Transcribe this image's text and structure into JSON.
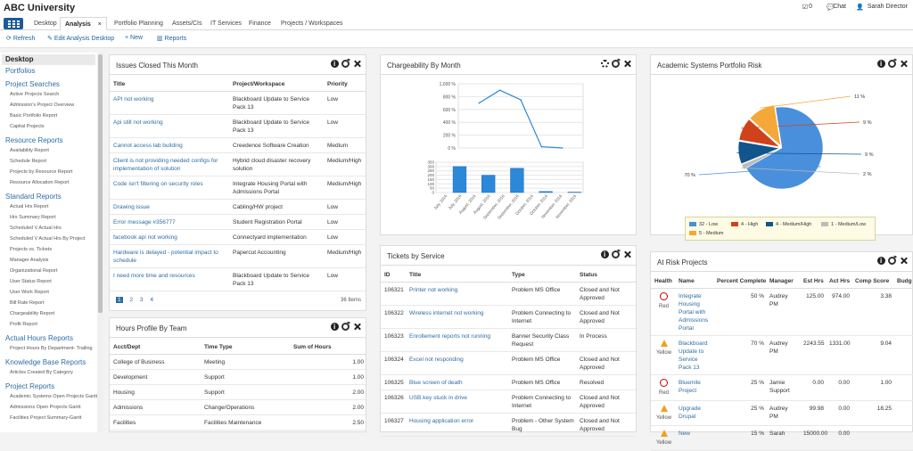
{
  "app": {
    "title": "ABC University",
    "checks_count": "0",
    "chat_label": "Chat",
    "user_name": "Sarah Director"
  },
  "tabs": [
    {
      "label": "Desktop"
    },
    {
      "label": "Analysis"
    },
    {
      "label": "Portfolio Planning"
    },
    {
      "label": "Assets/CIs"
    },
    {
      "label": "IT Services"
    },
    {
      "label": "Finance"
    },
    {
      "label": "Projects / Workspaces"
    }
  ],
  "toolbar": {
    "refresh": "Refresh",
    "edit": "Edit Analysis Desktop",
    "new": "New",
    "reports": "Reports"
  },
  "sidebar": {
    "desktop": "Desktop",
    "portfolios": "Portfolios",
    "project_searches": "Project Searches",
    "project_searches_items": [
      "Active Projects Search",
      "Admission's Project Overview",
      "Basic Portfolio Report",
      "Capital Projects"
    ],
    "resource_reports": "Resource Reports",
    "resource_reports_items": [
      "Availability Report",
      "Schedule Report",
      "Projects by Resource Report",
      "Resource Allocation Report"
    ],
    "standard_reports": "Standard Reports",
    "standard_reports_items": [
      "Actual Hrs Report",
      "Hrs Summary Report",
      "Scheduled V Actual Hrs",
      "Scheduled V Actual Hrs By Project",
      "Projects vs. Tickets",
      "Manager Analysis",
      "Organizational Report",
      "User Status Report",
      "User Work Report",
      "Bill Rate Report",
      "Chargeability Report",
      "Profit Report"
    ],
    "actual_hours_reports": "Actual Hours Reports",
    "actual_hours_items": [
      "Project Hours By Department- Trailing"
    ],
    "knowledge_base_reports": "Knowledge Base Reports",
    "knowledge_base_items": [
      "Articles Created By Category"
    ],
    "project_reports": "Project Reports",
    "project_reports_items": [
      "Academic Systems Open Projects Gantt",
      "Admissions Open Projects Gantt",
      "Facilities Project Summary-Gantt"
    ]
  },
  "issues": {
    "title": "Issues Closed This Month",
    "columns": [
      "Title",
      "Project/Workspace",
      "Priority"
    ],
    "rows": [
      {
        "title": "API not working",
        "project": "Blackboard Update to Service Pack 13",
        "priority": "Low"
      },
      {
        "title": "Api still not working",
        "project": "Blackboard Update to Service Pack 13",
        "priority": "Low"
      },
      {
        "title": "Cannot access lab building",
        "project": "Creedence Software Creation",
        "priority": "Medium"
      },
      {
        "title": "Client is not providing needed configs for implementation of solution",
        "project": "Hybrid cloud disaster recovery solution",
        "priority": "Medium/High"
      },
      {
        "title": "Code isn't filtering on security roles",
        "project": "Integrate Housing Portal with Admissions Portal",
        "priority": "Medium/High"
      },
      {
        "title": "Drawing issue",
        "project": "Cabling/HW project",
        "priority": "Low"
      },
      {
        "title": "Error message #356777",
        "project": "Student Registration Portal",
        "priority": "Low"
      },
      {
        "title": "facebook api not working",
        "project": "Connectyard implementation",
        "priority": "Low"
      },
      {
        "title": "Hardware is delayed - potential impact to schedule",
        "project": "Papercut Accounting",
        "priority": "Medium/High"
      },
      {
        "title": "I need more time and resources",
        "project": "Blackboard Update to Service Pack 13",
        "priority": "Low"
      }
    ],
    "pages": [
      "1",
      "2",
      "3",
      "4"
    ],
    "items_count": "36 Items"
  },
  "hours": {
    "title": "Hours Profile By Team",
    "columns": [
      "Acct/Dept",
      "Time Type",
      "Sum of Hours"
    ],
    "rows": [
      {
        "dept": "College of Business",
        "type": "Meeting",
        "sum": "1.00"
      },
      {
        "dept": "Development",
        "type": "Support",
        "sum": "1.00"
      },
      {
        "dept": "Housing",
        "type": "Support",
        "sum": "2.00"
      },
      {
        "dept": "Admissions",
        "type": "Change/Operations",
        "sum": "2.00"
      },
      {
        "dept": "Facilities",
        "type": "Facilities Maintenance",
        "sum": "2.50"
      }
    ]
  },
  "chargeability": {
    "title": "Chargeability By Month"
  },
  "chart_data": [
    {
      "type": "line",
      "title": "",
      "categories": [
        "July, 2016",
        "August, 2016",
        "September, 2016",
        "October, 2016",
        "November, 2016"
      ],
      "values": [
        700,
        900,
        750,
        20,
        0
      ],
      "ylim": [
        0,
        1000
      ],
      "yticks": [
        "1,000 %",
        "800 %",
        "600 %",
        "400 %",
        "200 %",
        "0 %"
      ]
    },
    {
      "type": "bar",
      "title": "",
      "categories": [
        "July, 2016",
        "July, 2016",
        "August, 2016",
        "August, 2016",
        "September, 2016",
        "September, 2016",
        "October, 2016",
        "October, 2016",
        "November, 2016",
        "November, 2016"
      ],
      "values": [
        0,
        300,
        0,
        200,
        0,
        280,
        0,
        12,
        0,
        5
      ],
      "ylim": [
        0,
        350
      ],
      "yticks": [
        "350",
        "300",
        "250",
        "200",
        "150",
        "100",
        "50",
        "0"
      ]
    },
    {
      "type": "pie",
      "title": "",
      "categories": [
        "32 - Low",
        "4 - High",
        "4 - Medium/High",
        "1 - Medium/Low",
        "5 - Medium"
      ],
      "values": [
        70,
        9,
        9,
        2,
        11
      ],
      "labels": [
        "70 %",
        "9 %",
        "9 %",
        "2 %",
        "11 %"
      ],
      "colors": [
        "#4a8fdc",
        "#d0421b",
        "#10558c",
        "#bbbbbb",
        "#f4a838"
      ],
      "legend": "bottom"
    }
  ],
  "risk": {
    "title": "Academic Systems Portfolio Risk"
  },
  "tickets": {
    "title": "Tickets by Service",
    "columns": [
      "ID",
      "Title",
      "Type",
      "Status"
    ],
    "rows": [
      {
        "id": "106321",
        "title": "Printer not working",
        "type": "Problem MS Office",
        "status": "Closed and Not Approved"
      },
      {
        "id": "106322",
        "title": "Wireless internet not working",
        "type": "Problem Connecting to Internet",
        "status": "Closed and Not Approved"
      },
      {
        "id": "106323",
        "title": "Enrollement reports not running",
        "type": "Banner Security Class Request",
        "status": "In Process"
      },
      {
        "id": "106324",
        "title": "Excel not responding",
        "type": "Problem MS Office",
        "status": "Closed and Not Approved"
      },
      {
        "id": "106325",
        "title": "Blue screen of death",
        "type": "Problem MS Office",
        "status": "Resolved"
      },
      {
        "id": "106326",
        "title": "USB key stuck in drive",
        "type": "Problem Connecting to Internet",
        "status": "Closed and Not Approved"
      },
      {
        "id": "106327",
        "title": "Housing application error",
        "type": "Problem - Other System Bug",
        "status": "Closed and Not Approved"
      }
    ]
  },
  "atrisk": {
    "title": "At Risk Projects",
    "columns": [
      "Health",
      "Name",
      "Percent Complete",
      "Manager",
      "Est Hrs",
      "Act Hrs",
      "Comp Score",
      "Budg"
    ],
    "rows": [
      {
        "health": "Red",
        "name": "Integrate Housing Portal with Admissions Portal",
        "pct": "50 %",
        "manager": "Audrey PM",
        "est": "125.00",
        "act": "974.00",
        "score": "3.38"
      },
      {
        "health": "Yellow",
        "name": "Blackboard Update to Service Pack 13",
        "pct": "70 %",
        "manager": "Audrey PM",
        "est": "2243.55",
        "act": "1331.00",
        "score": "9.04"
      },
      {
        "health": "Red",
        "name": "Bluemile Project",
        "pct": "25 %",
        "manager": "Jamie Support",
        "est": "0.00",
        "act": "0.00",
        "score": "1.00"
      },
      {
        "health": "Yellow",
        "name": "Upgrade Drupal",
        "pct": "25 %",
        "manager": "Audrey PM",
        "est": "99.98",
        "act": "0.00",
        "score": "18.25"
      },
      {
        "health": "Yellow",
        "name": "New",
        "pct": "15 %",
        "manager": "Sarah",
        "est": "15000.00",
        "act": "0.00",
        "score": ""
      }
    ]
  }
}
